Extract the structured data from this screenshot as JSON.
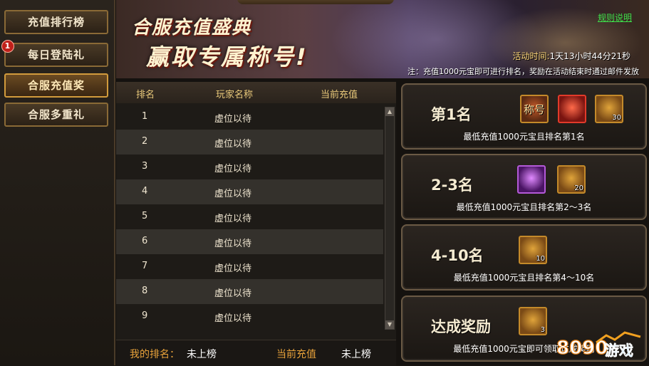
{
  "sidebar": {
    "items": [
      {
        "label": "充值排行榜",
        "active": false
      },
      {
        "label": "每日登陆礼",
        "active": false,
        "badge": "1"
      },
      {
        "label": "合服充值奖",
        "active": true
      },
      {
        "label": "合服多重礼",
        "active": false
      }
    ]
  },
  "banner": {
    "title_line1": "合服充值盛典",
    "title_line2": "赢取专属称号!",
    "rules_link": "规则说明",
    "time_label": "活动时间:",
    "time_value": "1天13小时44分21秒",
    "notice": "注：充值1000元宝即可进行排名，奖励在活动结束时通过邮件发放"
  },
  "table": {
    "headers": [
      "排名",
      "玩家名称",
      "当前充值"
    ],
    "rows": [
      {
        "rank": "1",
        "name": "虚位以待",
        "amount": ""
      },
      {
        "rank": "2",
        "name": "虚位以待",
        "amount": ""
      },
      {
        "rank": "3",
        "name": "虚位以待",
        "amount": ""
      },
      {
        "rank": "4",
        "name": "虚位以待",
        "amount": ""
      },
      {
        "rank": "5",
        "name": "虚位以待",
        "amount": ""
      },
      {
        "rank": "6",
        "name": "虚位以待",
        "amount": ""
      },
      {
        "rank": "7",
        "name": "虚位以待",
        "amount": ""
      },
      {
        "rank": "8",
        "name": "虚位以待",
        "amount": ""
      },
      {
        "rank": "9",
        "name": "虚位以待",
        "amount": ""
      }
    ]
  },
  "my_rank": {
    "rank_label": "我的排名：",
    "rank_value": "未上榜",
    "charge_label": "当前充值",
    "charge_value": "未上榜"
  },
  "rewards": [
    {
      "title": "第1名",
      "condition": "最低充值1000元宝且排名第1名",
      "items": [
        {
          "kind": "title-item",
          "glyph": "称号",
          "count": ""
        },
        {
          "kind": "red",
          "glyph": "",
          "count": ""
        },
        {
          "kind": "gold",
          "glyph": "",
          "count": "30"
        }
      ]
    },
    {
      "title": "2-3名",
      "condition": "最低充值1000元宝且排名第2～3名",
      "items": [
        {
          "kind": "purple",
          "glyph": "",
          "count": ""
        },
        {
          "kind": "gold",
          "glyph": "",
          "count": "20"
        }
      ]
    },
    {
      "title": "4-10名",
      "condition": "最低充值1000元宝且排名第4～10名",
      "items": [
        {
          "kind": "gold",
          "glyph": "",
          "count": "10"
        }
      ]
    },
    {
      "title": "达成奖励",
      "condition": "最低充值1000元宝即可领取达成奖励",
      "items": [
        {
          "kind": "gold",
          "glyph": "",
          "count": "3"
        }
      ]
    }
  ],
  "watermark": {
    "text": "8090游戏"
  },
  "colors": {
    "accent": "#d29b3c",
    "link": "#3fe04a",
    "highlight": "#e8a23a"
  }
}
